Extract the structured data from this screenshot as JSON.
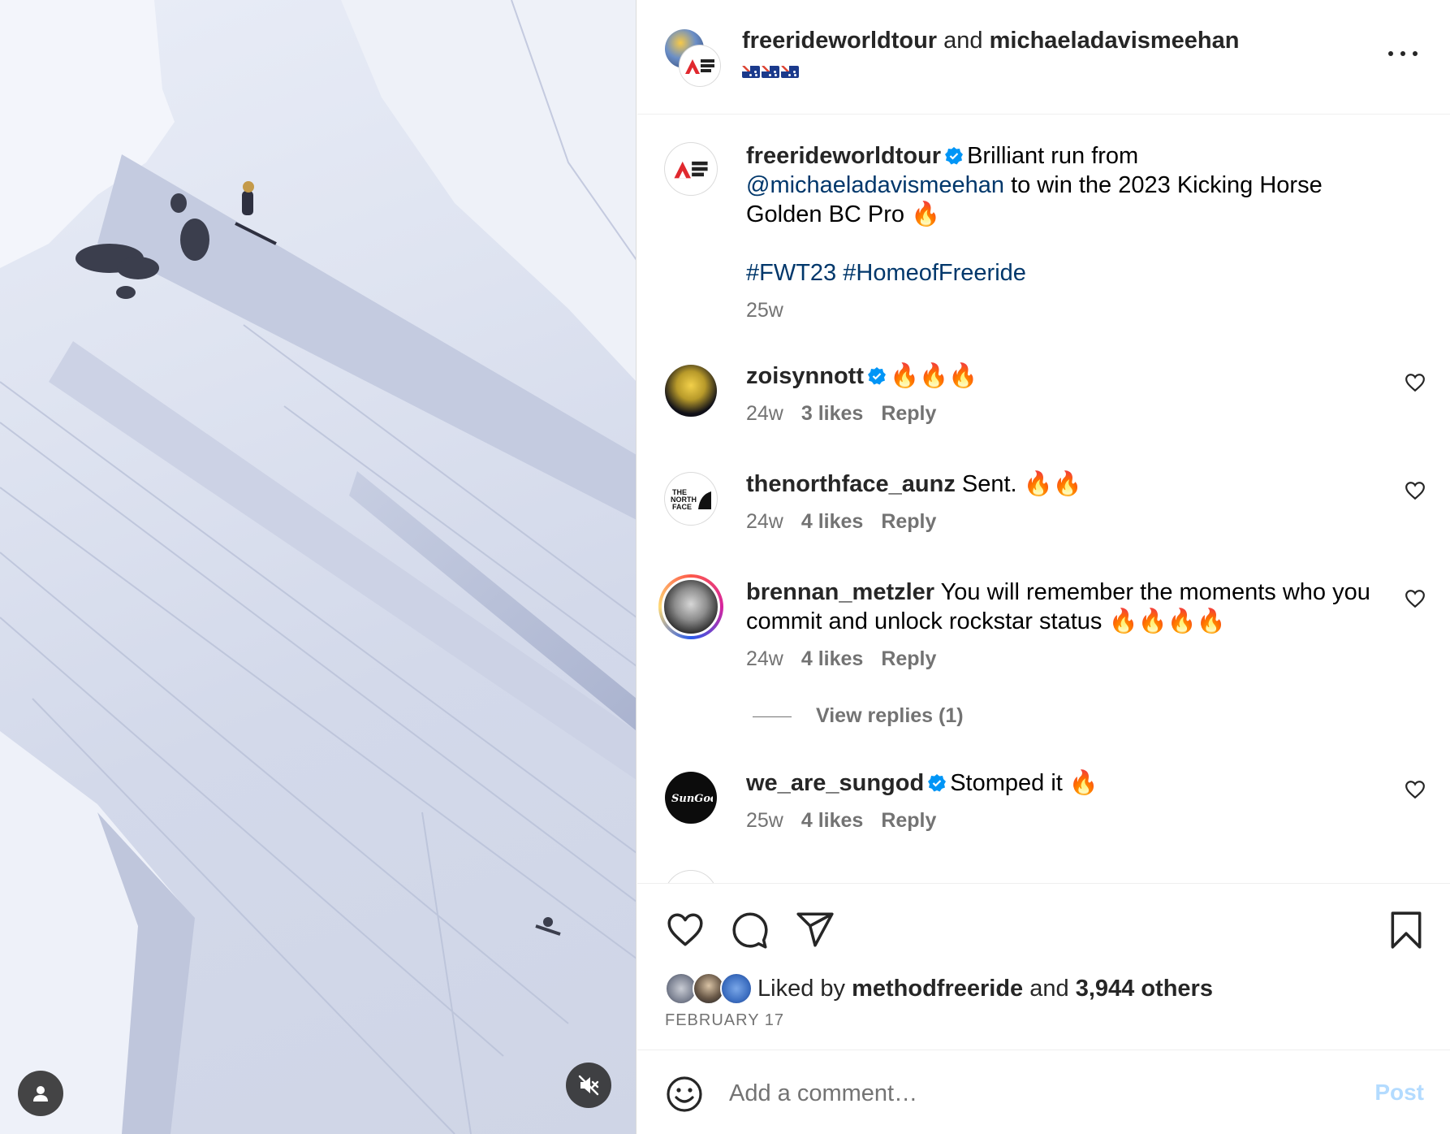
{
  "header": {
    "user1": "freerideworldtour",
    "and_text": "and",
    "user2": "michaeladavismeehan",
    "flags": "🇦🇺🇦🇺🇦🇺"
  },
  "caption": {
    "username": "freerideworldtour",
    "text_before": "Brilliant run from",
    "mention": "@michaeladavismeehan",
    "text_after": "to win the 2023 Kicking Horse Golden BC Pro 🔥",
    "hashtags": "#FWT23 #HomeofFreeride",
    "time": "25w"
  },
  "comments": [
    {
      "username": "zoisynnott",
      "verified": true,
      "text": "🔥🔥🔥",
      "time": "24w",
      "likes": "3 likes",
      "reply": "Reply"
    },
    {
      "username": "thenorthface_aunz",
      "verified": false,
      "text": "Sent. 🔥🔥",
      "time": "24w",
      "likes": "4 likes",
      "reply": "Reply"
    },
    {
      "username": "brennan_metzler",
      "verified": false,
      "text": "You will remember the moments who you commit and unlock rockstar status 🔥🔥🔥🔥",
      "time": "24w",
      "likes": "4 likes",
      "reply": "Reply",
      "view_replies": "View replies (1)"
    },
    {
      "username": "we_are_sungod",
      "verified": true,
      "text": "Stomped it 🔥",
      "time": "25w",
      "likes": "4 likes",
      "reply": "Reply"
    }
  ],
  "likes": {
    "prefix": "Liked by",
    "user": "methodfreeride",
    "and_text": "and",
    "others": "3,944 others"
  },
  "date": "FEBRUARY 17",
  "comment_box": {
    "placeholder": "Add a comment…",
    "post_label": "Post"
  },
  "logos": {
    "fwt": "FREERIDE WORLD TOUR",
    "tnf": "THE NORTH FACE",
    "sungod": "SunGod"
  },
  "icons": {
    "verified_color": "#0095f6",
    "link_color": "#00376b"
  }
}
